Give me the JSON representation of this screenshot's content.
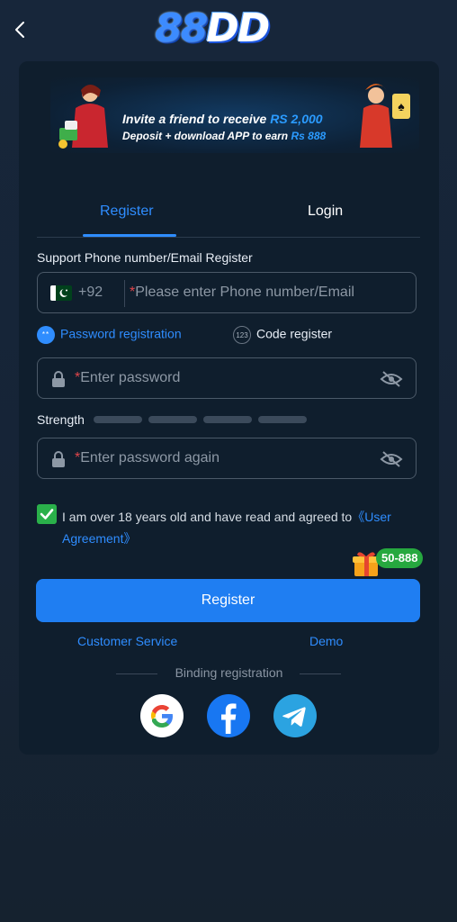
{
  "header": {
    "logo_text_num": "88",
    "logo_text_letters": "DD"
  },
  "banner": {
    "line1_text": "Invite a friend to receive",
    "line1_amount": "RS 2,000",
    "line2_text": "Deposit + download APP to earn",
    "line2_amount": "Rs 888"
  },
  "tabs": [
    {
      "label": "Register",
      "active": true
    },
    {
      "label": "Login",
      "active": false
    }
  ],
  "form": {
    "support_label": "Support Phone number/Email Register",
    "country_code": "+92",
    "phone_placeholder": "Please enter Phone number/Email",
    "required_mark": "*",
    "mode_password_label": "Password registration",
    "mode_code_label": "Code register",
    "mode_code_icon_text": "123",
    "mode_password_icon_text": "**",
    "password_placeholder": "Enter password",
    "strength_label": "Strength",
    "strength_level": 0,
    "password_again_placeholder": "Enter password again",
    "agree_checked": true,
    "agree_text": "I am over 18 years old and have read and agreed to",
    "agree_link": "《User Agreement》",
    "gift_badge": "50-888",
    "register_button": "Register"
  },
  "links": {
    "customer_service": "Customer Service",
    "demo": "Demo"
  },
  "binding": {
    "label": "Binding registration",
    "providers": [
      "google",
      "facebook",
      "telegram"
    ]
  },
  "colors": {
    "accent": "#2f8dff",
    "button": "#1f7ef2",
    "required": "#e0454b",
    "check": "#2ab04a",
    "card_bg": "#0f1e2d",
    "page_bg": "#17263a"
  }
}
